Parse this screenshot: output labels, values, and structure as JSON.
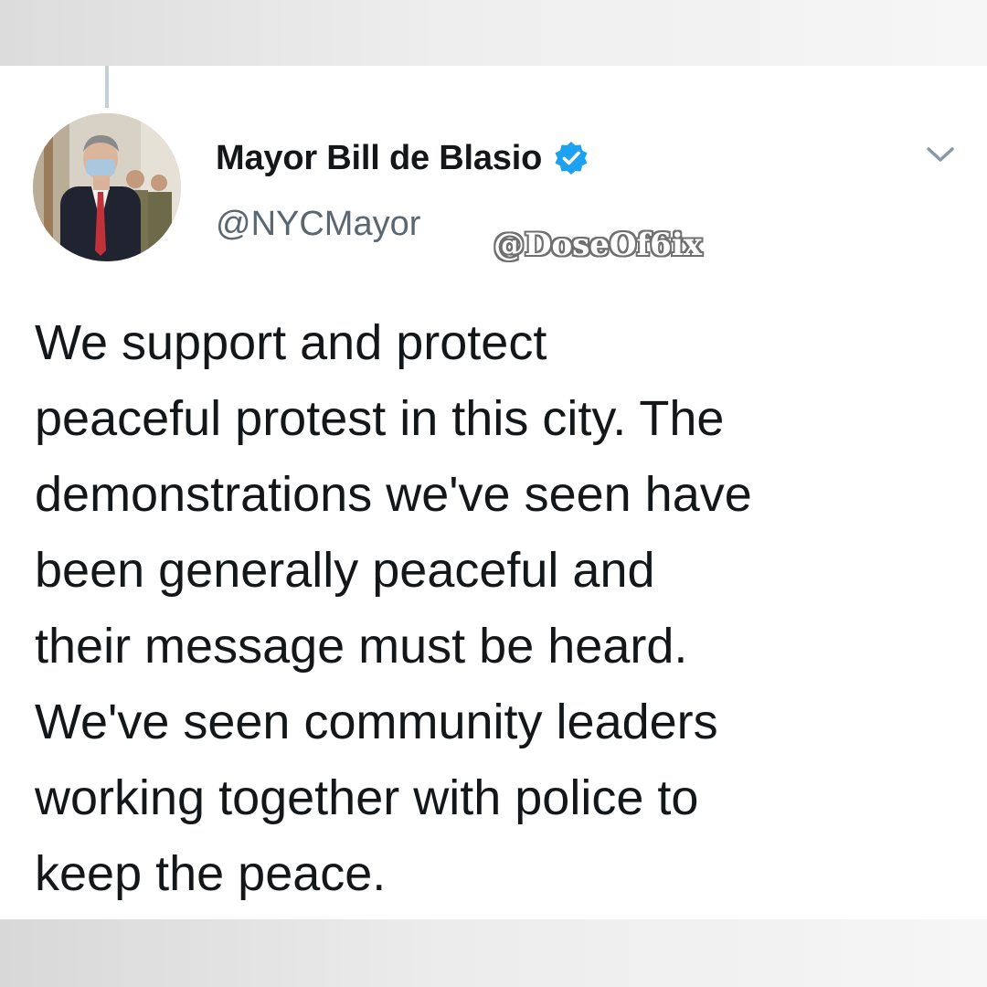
{
  "tweet": {
    "display_name": "Mayor Bill de Blasio",
    "handle": "@NYCMayor",
    "verified": true,
    "avatar_icon": "profile-photo",
    "menu_icon": "chevron-down-icon",
    "text_lines": [
      "We support and protect",
      "peaceful protest in this city. The",
      "demonstrations we've seen have",
      "been generally peaceful and",
      "their message must be heard.",
      "We've seen community leaders",
      "working together with police to",
      "keep the peace."
    ]
  },
  "watermark": "@DoseOf6ix",
  "colors": {
    "verified_badge": "#1da1f2",
    "text": "#14171a",
    "handle": "#5b6770",
    "background": "#ffffff"
  }
}
